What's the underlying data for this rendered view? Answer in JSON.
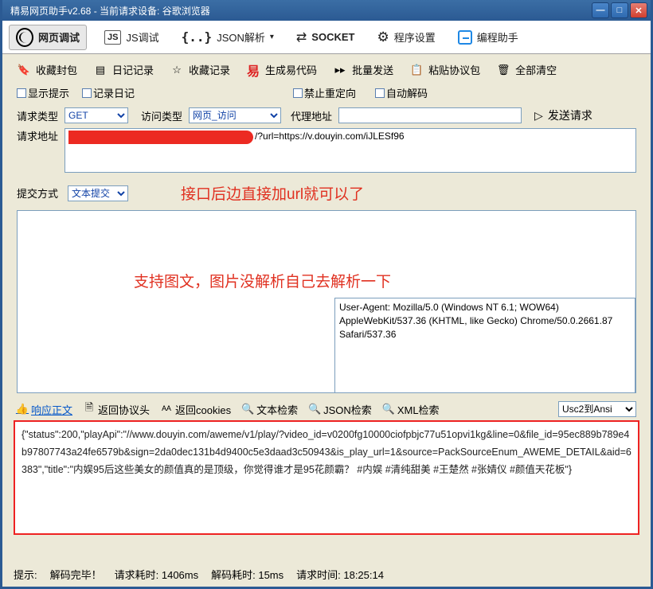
{
  "title": "精易网页助手v2.68      -    当前请求设备:  谷歌浏览器",
  "nav": {
    "web_debug": "网页调试",
    "js_debug": "JS调试",
    "json_parse": "JSON解析",
    "socket": "SOCKET",
    "prog_set": "程序设置",
    "assist": "编程助手"
  },
  "toolbar2": {
    "fav": "收藏封包",
    "diary": "日记记录",
    "favrec": "收藏记录",
    "gen": "生成易代码",
    "batch": "批量发送",
    "paste": "粘贴协议包",
    "clear": "全部清空"
  },
  "opts": {
    "show_hint": "显示提示",
    "log_diary": "记录日记",
    "no_redirect": "禁止重定向",
    "auto_decode": "自动解码"
  },
  "labels": {
    "req_type": "请求类型",
    "access_type": "访问类型",
    "proxy": "代理地址",
    "send": "发送请求",
    "req_url": "请求地址",
    "submit_mode": "提交方式"
  },
  "values": {
    "req_type": "GET",
    "access_type": "网页_访问",
    "proxy": "",
    "url_suffix": "/?url=https://v.douyin.com/iJLESf96",
    "submit_mode": "文本提交"
  },
  "annotations": {
    "a1": "接口后边直接加url就可以了",
    "a2": "支持图文，图片没解析自己去解析一下"
  },
  "user_agent": "User-Agent: Mozilla/5.0 (Windows NT 6.1; WOW64) AppleWebKit/537.36 (KHTML, like Gecko) Chrome/50.0.2661.87 Safari/537.36",
  "tabs": {
    "resp_body": "响应正文",
    "resp_head": "返回协议头",
    "resp_cookies": "返回cookies",
    "text_search": "文本检索",
    "json_search": "JSON检索",
    "xml_search": "XML检索"
  },
  "encoding": "Usc2到Ansi",
  "response_body": "{\"status\":200,\"playApi\":\"//www.douyin.com/aweme/v1/play/?video_id=v0200fg10000ciofpbjc77u51opvi1kg&line=0&file_id=95ec889b789e4b97807743a24fe6579b&sign=2da0dec131b4d9400c5e3daad3c50943&is_play_url=1&source=PackSourceEnum_AWEME_DETAIL&aid=6383\",\"title\":\"内娱95后这些美女的颜值真的是顶级，你觉得谁才是95花颜霸？  #内娱  #清纯甜美 #王楚然 #张婧仪 #颜值天花板\"}",
  "status": {
    "hint": "提示:",
    "decode_done": "解码完毕！",
    "req_time": "请求耗时:  1406ms",
    "dec_time": "解码耗时:  15ms",
    "req_clock": "请求时间:   18:25:14"
  }
}
